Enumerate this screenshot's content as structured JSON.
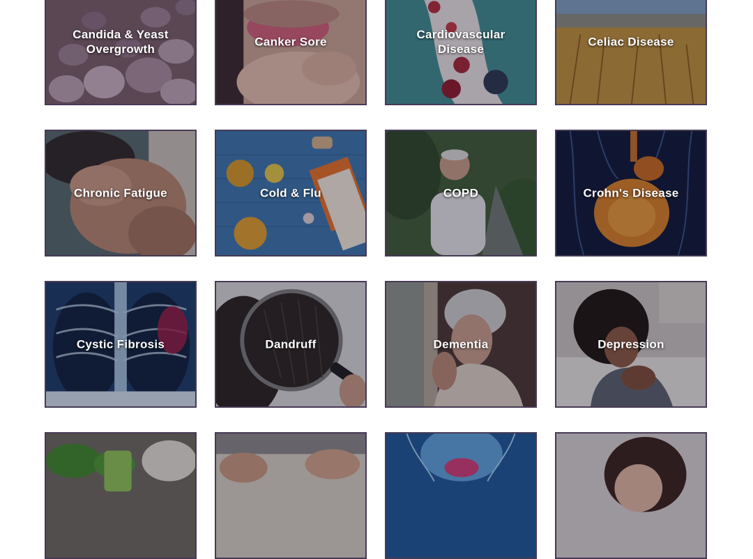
{
  "tiles": [
    {
      "label": "Candida & Yeast\nOvergrowth"
    },
    {
      "label": "Canker Sore"
    },
    {
      "label": "Cardiovascular\nDisease"
    },
    {
      "label": "Celiac Disease"
    },
    {
      "label": "Chronic Fatigue"
    },
    {
      "label": "Cold & Flu"
    },
    {
      "label": "COPD"
    },
    {
      "label": "Crohn's Disease"
    },
    {
      "label": "Cystic Fibrosis"
    },
    {
      "label": "Dandruff"
    },
    {
      "label": "Dementia"
    },
    {
      "label": "Depression"
    }
  ],
  "colors": {
    "tile_border": "#463a55",
    "label_text": "#ffffff"
  }
}
